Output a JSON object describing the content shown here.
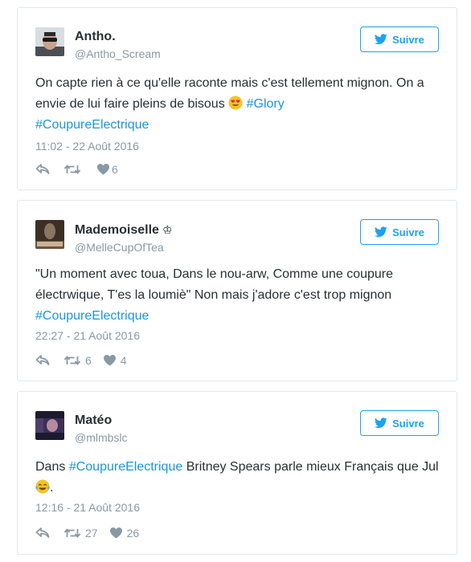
{
  "follow_label": "Suivre",
  "colors": {
    "link": "#1b95e0",
    "follow": "#1da1f2",
    "muted": "#8899a6"
  },
  "tweets": [
    {
      "display_name": "Antho.",
      "handle": "@Antho_Scream",
      "text_parts": [
        "On capte rien à ce qu'elle raconte mais c'est tellement mignon. On a envie de lui faire pleins de bisous",
        "#Glory",
        "#CoupureElectrique"
      ],
      "emoji": "heart-eyes-emoji",
      "timestamp": "11:02 - 22 Août 2016",
      "retweets": "",
      "likes": "6"
    },
    {
      "display_name": "Mademoiselle",
      "badge": "♔",
      "handle": "@MelleCupOfTea",
      "text_parts": [
        "\"Un moment avec toua, Dans le nou-arw, Comme une coupure électrwique, T'es la loumiè\" Non mais j'adore c'est trop mignon",
        "#CoupureElectrique"
      ],
      "timestamp": "22:27 - 21 Août 2016",
      "retweets": "6",
      "likes": "4"
    },
    {
      "display_name": "Matéo",
      "handle": "@mlmbslc",
      "text_parts": [
        "Dans",
        "#CoupureElectrique",
        "Britney Spears parle mieux Français que Jul",
        "."
      ],
      "emoji": "tears-of-joy-emoji",
      "timestamp": "12:16 - 21 Août 2016",
      "retweets": "27",
      "likes": "26"
    }
  ]
}
